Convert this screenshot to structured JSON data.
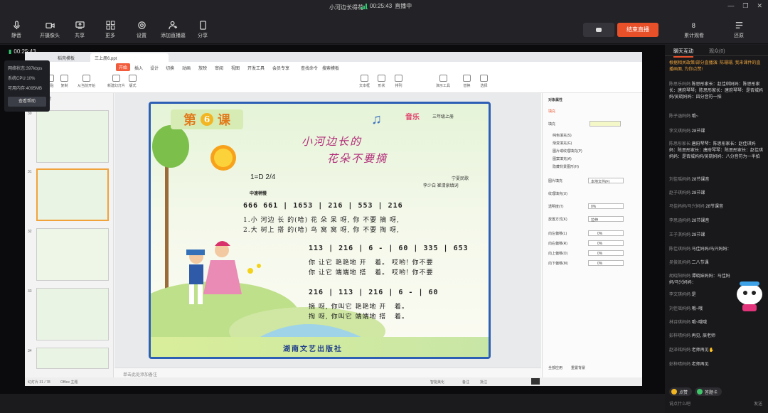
{
  "window": {
    "title": "小河边长得花...",
    "timer": "00:25:43",
    "status": "直播中"
  },
  "toolbar": {
    "mic": "静音",
    "camera": "开摄像头",
    "share": "共享",
    "more": "更多",
    "settings": "设置",
    "add_streamer": "添加直播嘉",
    "share2": "分享",
    "end_live": "结束直播",
    "stats": "累计观看",
    "restore": "还原"
  },
  "overlay": {
    "timer": "00:25:43",
    "net_status_label": "网络状态:",
    "net_status_value": "397kbps",
    "cpu_label": "系统CPU:",
    "cpu_value": "10%",
    "mem_label": "可用内存:",
    "mem_value": "4095MB",
    "help_button": "查看帮助"
  },
  "shared_app": {
    "tabs": [
      "稻壳模板",
      "三上册6.ppt"
    ],
    "menu": [
      "开始",
      "插入",
      "设计",
      "切换",
      "动画",
      "放映",
      "审阅",
      "视图",
      "开发工具",
      "会员专享",
      "查找命令",
      "搜索模板"
    ],
    "ribbon": [
      "粘贴",
      "复制",
      "格式刷",
      "从当前开始",
      "新建幻灯片",
      "版式",
      "节",
      "重置",
      "文本框",
      "形状",
      "排列",
      "轮廓",
      "演示工具",
      "替换",
      "选择"
    ],
    "thumbs_header": [
      "大纲",
      "幻灯片"
    ],
    "slide_numbers": [
      "30",
      "31",
      "32",
      "33",
      "34"
    ],
    "notes_placeholder": "单击此处添加备注",
    "status_left": "幻灯片 31 / 78",
    "status_theme": "Office 主题",
    "status_right": [
      "智能美化",
      "备注",
      "批注"
    ]
  },
  "slide": {
    "lesson_prefix": "第",
    "lesson_number": "6",
    "lesson_suffix": "课",
    "subject": "音乐",
    "grade": "三年级上册",
    "title_line1": "小河边长的",
    "title_line2": "花朵不要摘",
    "key_signature": "1=D  2/4",
    "tempo": "中速稍慢",
    "credit_folk": "宁夏民歌",
    "credit_lyrics": "李少白 崔清泉填词",
    "notation_row1": "666 661 | 1653 | 216 | 553 | 216",
    "lyric_row1": "1.小 河边 长 的(哈) 花 朵 呆 呀, 你 不要 摘 呀,",
    "lyric_row2": "2.大 树上 搭 的(哈) 鸟 窝 窝 呀, 你 不要 掏 呀,",
    "notation_row2": "113 | 216 | 6 - | 60 | 335 | 653",
    "lyric_row3": "你 让它 艳艳地 开   着。 哎哟! 你不要",
    "lyric_row4": "你 让它 端端地 搭   着。 哎哟! 你不要",
    "notation_row3": "216 | 113 | 216 | 6 - | 60",
    "lyric_row5": "摘 呀, 你叫它 艳艳地 开   着。",
    "lyric_row6": "掏 呀, 你叫它 端端地 搭   着。",
    "publisher": "湖南文艺出版社"
  },
  "properties": {
    "title": "对象属性",
    "tab": "填充",
    "section": "填充",
    "options": [
      "纯色填充(S)",
      "渐变填充(G)",
      "图片或纹理填充(P)",
      "图案填充(A)",
      "隐藏背景图形(H)"
    ],
    "image_fill": "图片填充",
    "image_fill_value": "本地文件(F)",
    "texture_fill": "纹理填充(U)",
    "transparency": "透明度(T)",
    "transparency_value": "0%",
    "placement": "放置方式(K)",
    "placement_value": "拉伸",
    "offsets": [
      {
        "label": "向左偏移(L)",
        "value": "0%"
      },
      {
        "label": "向右偏移(R)",
        "value": "0%"
      },
      {
        "label": "向上偏移(O)",
        "value": "0%"
      },
      {
        "label": "向下偏移(M)",
        "value": "0%"
      }
    ],
    "apply_all": "全部应用",
    "reset": "重置背景"
  },
  "chat": {
    "tabs": [
      "聊天互动",
      "观众(0)"
    ],
    "notice": "根据相关政策/部分直播演: 陈珊珊, 我来课件的直播画面, 为你点赞!",
    "messages": [
      {
        "name": "陈思乐妈妈:",
        "text": "陈思彤家长：赵佳琪妈妈：陈思彤家长：唐府琴琴；陈思彤家长：唐府琴琴：是否城妈妈/吴晓妈妈：四分音符一拍"
      },
      {
        "name": "陈子涵妈妈:",
        "text": "哦~"
      },
      {
        "name": "李文琪妈妈:",
        "text": "28节课"
      },
      {
        "name": "陈思彤家长:",
        "text": "唐府琴琴：陈思彤家长：赵佳琪妈妈：陈思彤家长：唐府琴琴：陈思彤家长：赵佳琪妈妈：是否城妈妈/吴晓妈妈：八分音符为一半拍"
      },
      {
        "name": "刘佳瑶妈妈:",
        "text": "28节课音"
      },
      {
        "name": "赵子琪妈妈:",
        "text": "28节课"
      },
      {
        "name": "马佳妈妈/马兴妈妈:",
        "text": "28节课音"
      },
      {
        "name": "李思涵妈妈:",
        "text": "28节课音"
      },
      {
        "name": "王子淇妈妈:",
        "text": "28节课"
      },
      {
        "name": "陈佳琪妈妈:",
        "text": "马佳妈妈/马兴妈妈："
      },
      {
        "name": "吴俊凯妈妈:",
        "text": "二八节课"
      },
      {
        "name": "胡晓阳妈妈:",
        "text": "谭晓妹妈妈：马佳妈妈/马兴妈妈："
      },
      {
        "name": "李文琪妈妈:",
        "text": "是"
      },
      {
        "name": "刘佳瑶妈妈:",
        "text": "哦~哦"
      },
      {
        "name": "林诗琪妈妈:",
        "text": "哦~哦哦"
      },
      {
        "name": "彭梓晴妈妈:",
        "text": "再见, 辰老师"
      },
      {
        "name": "赵泽铭妈妈:",
        "text": "老师再见✋"
      },
      {
        "name": "彭梓晴妈妈:",
        "text": "老师再见"
      }
    ],
    "chips": [
      "点赞",
      "答题卡"
    ],
    "input_placeholder": "说点什么吧",
    "send": "发送"
  }
}
